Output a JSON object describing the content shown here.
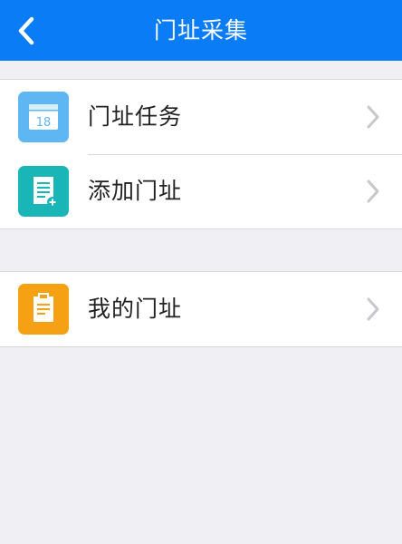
{
  "header": {
    "title": "门址采集",
    "back_icon": "chevron-left-icon",
    "background_color": "#0a7cf5"
  },
  "menu_groups": [
    {
      "items": [
        {
          "label": "门址任务",
          "icon": "calendar-icon",
          "icon_text": "18",
          "icon_color": "#5eb6f3"
        },
        {
          "label": "添加门址",
          "icon": "add-document-icon",
          "icon_color": "#1ab5b6"
        }
      ]
    },
    {
      "items": [
        {
          "label": "我的门址",
          "icon": "clipboard-icon",
          "icon_color": "#f6a114"
        }
      ]
    }
  ],
  "chevron_icon": "chevron-right-icon",
  "chevron_color": "#c7c7cc"
}
